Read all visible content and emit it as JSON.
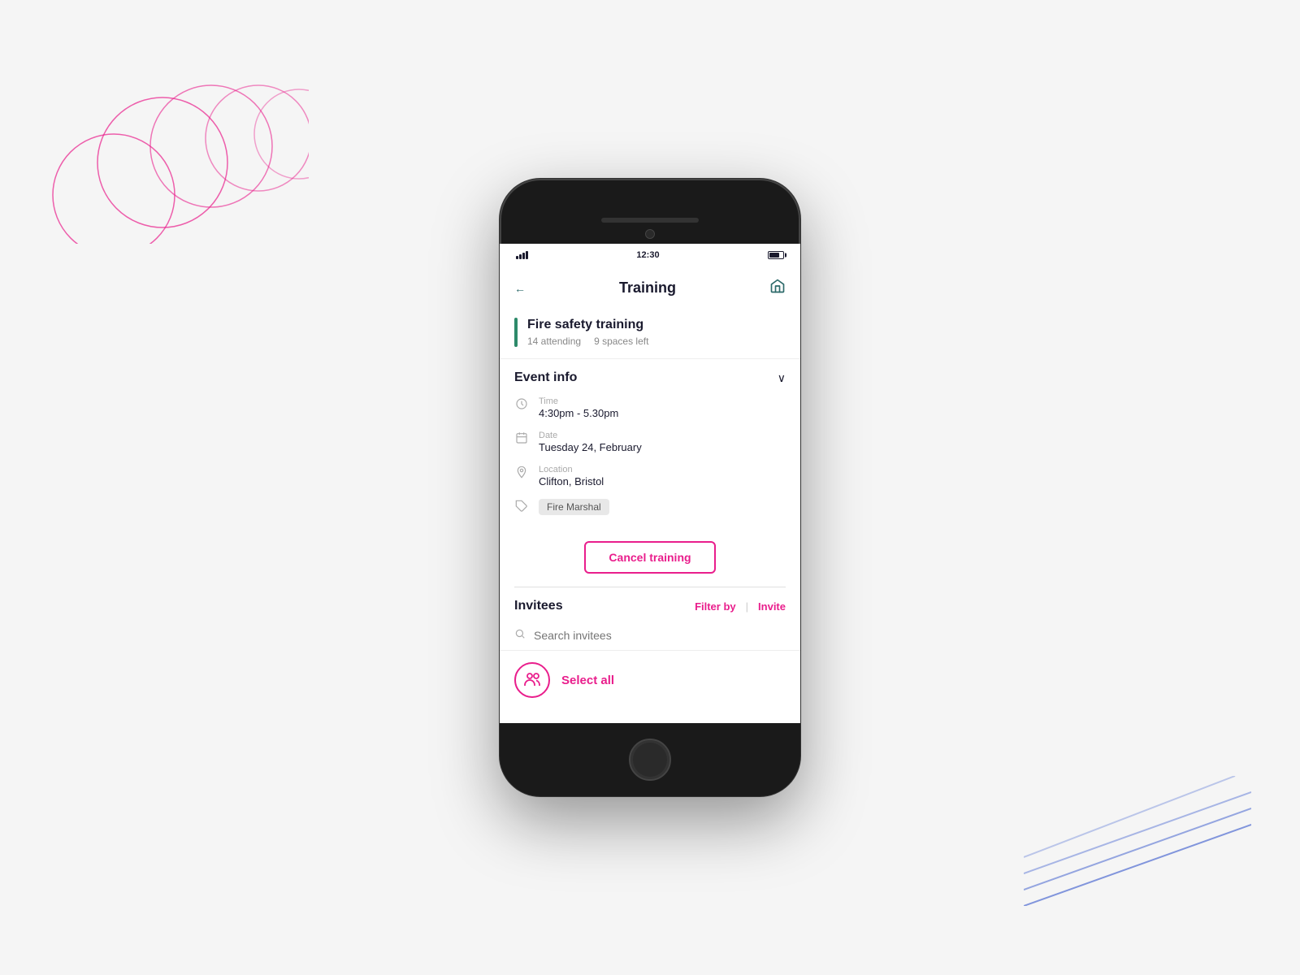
{
  "page": {
    "background": "#f5f5f5"
  },
  "status_bar": {
    "signal": "signal",
    "time": "12:30",
    "battery": "battery"
  },
  "header": {
    "back_label": "←",
    "title": "Training",
    "home_icon": "⌂"
  },
  "event": {
    "title": "Fire safety training",
    "attending": "14 attending",
    "spaces_left": "9 spaces left"
  },
  "event_info_section": {
    "label": "Event info",
    "chevron": "∨",
    "time_label": "Time",
    "time_value": "4:30pm - 5.30pm",
    "date_label": "Date",
    "date_value": "Tuesday 24, February",
    "location_label": "Location",
    "location_value": "Clifton, Bristol",
    "tag_label": "Fire Marshal"
  },
  "cancel_button": {
    "label": "Cancel training"
  },
  "invitees": {
    "title": "Invitees",
    "filter_label": "Filter by",
    "invite_label": "Invite",
    "search_placeholder": "Search invitees",
    "select_all_label": "Select all"
  }
}
